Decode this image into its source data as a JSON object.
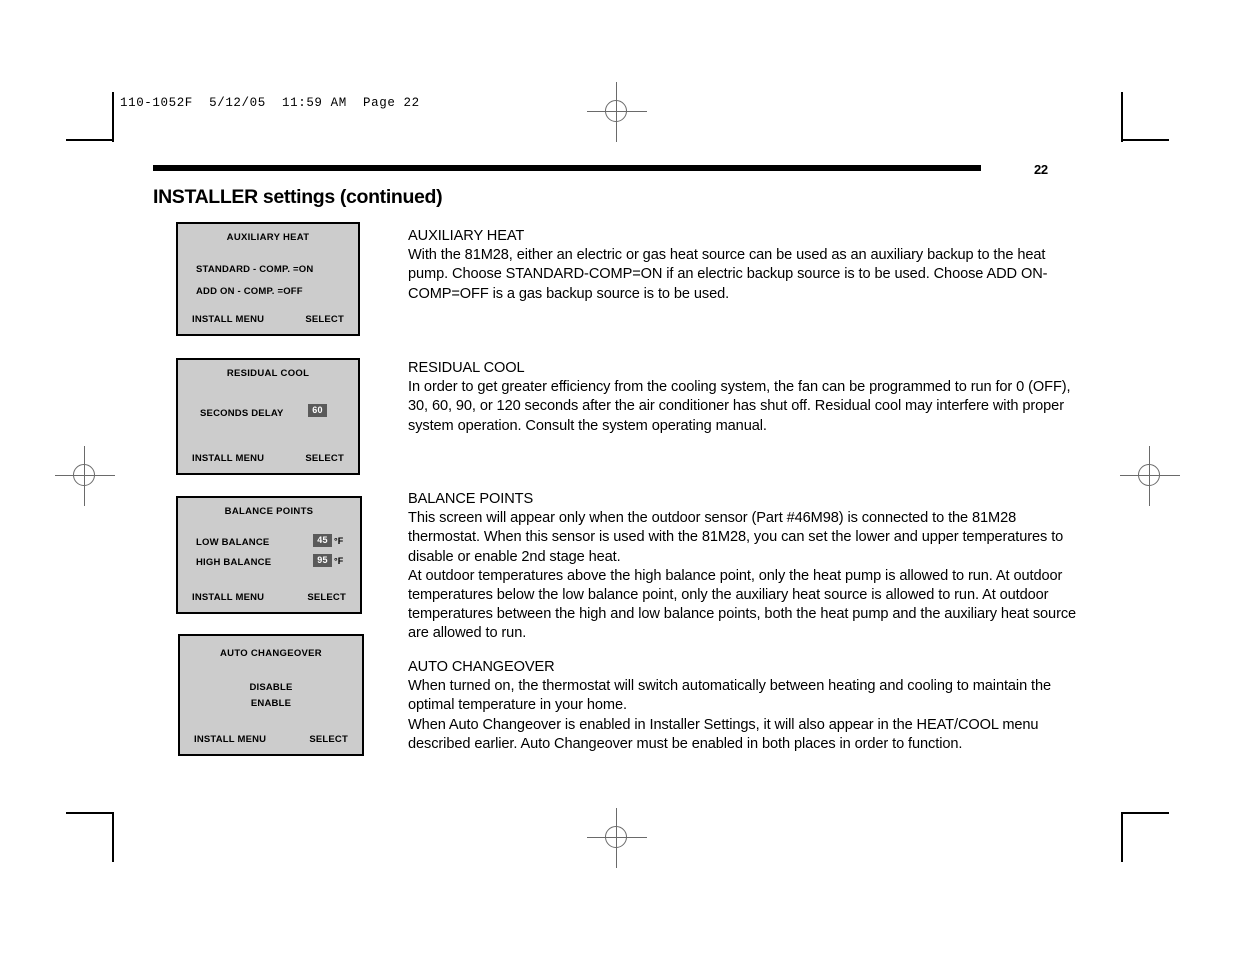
{
  "proof": {
    "slug": "110-1052F  5/12/05  11:59 AM  Page 22"
  },
  "page": {
    "number": "22",
    "title": "INSTALLER settings (continued)"
  },
  "screens": [
    {
      "name": "auxiliary-heat",
      "title": "AUXILIARY HEAT",
      "lines": [
        "STANDARD - COMP. =ON",
        "ADD ON - COMP. =OFF"
      ],
      "footer_left": "INSTALL MENU",
      "footer_right": "SELECT"
    },
    {
      "name": "residual-cool",
      "title": "RESIDUAL COOL",
      "row_label": "SECONDS DELAY",
      "row_value": "60",
      "footer_left": "INSTALL MENU",
      "footer_right": "SELECT"
    },
    {
      "name": "balance-points",
      "title": "BALANCE POINTS",
      "low_label": "LOW BALANCE",
      "low_value": "45",
      "low_unit": "°F",
      "high_label": "HIGH BALANCE",
      "high_value": "95",
      "high_unit": "°F",
      "footer_left": "INSTALL MENU",
      "footer_right": "SELECT"
    },
    {
      "name": "auto-changeover",
      "title": "AUTO CHANGEOVER",
      "option_disable": "DISABLE",
      "option_enable": "ENABLE",
      "footer_left": "INSTALL MENU",
      "footer_right": "SELECT"
    }
  ],
  "sections": {
    "auxiliary_heat": {
      "heading": "AUXILIARY HEAT",
      "body": "With the 81M28, either an electric or gas heat source can be used as an auxiliary backup to the heat pump. Choose STANDARD-COMP=ON if an electric backup source is to be used. Choose ADD ON-COMP=OFF is a gas backup source is to be used."
    },
    "residual_cool": {
      "heading": "RESIDUAL COOL",
      "body": "In order to get greater efficiency from the cooling system, the fan can be programmed to run for 0 (OFF), 30, 60, 90, or 120 seconds after the air conditioner has shut off. Residual cool may interfere with proper system operation. Consult the system operating manual."
    },
    "balance_points": {
      "heading": "BALANCE POINTS",
      "body1": "This screen will appear only when the outdoor sensor (Part #46M98) is connected to the 81M28 thermostat. When this sensor is used with the 81M28, you can set the lower and upper temperatures to disable or enable 2nd stage heat.",
      "body2": "At outdoor temperatures above the high balance point, only the heat pump is allowed to run. At outdoor temperatures below the low balance point, only the auxiliary heat source is allowed to run. At outdoor temperatures between the high and low balance points, both the heat pump and the auxiliary heat source are allowed to run."
    },
    "auto_changeover": {
      "heading": "AUTO CHANGEOVER",
      "body1": "When turned on, the thermostat will switch automatically between heating and cooling to maintain the optimal temperature in your home.",
      "body2": "When Auto Changeover is enabled in Installer Settings, it will also appear in the HEAT/COOL menu described earlier. Auto Changeover must be enabled in both places in order to function."
    }
  },
  "colors": {
    "lcd_background": "#cccccc",
    "badge_background": "#5a5a5a",
    "ink": "#000000"
  }
}
